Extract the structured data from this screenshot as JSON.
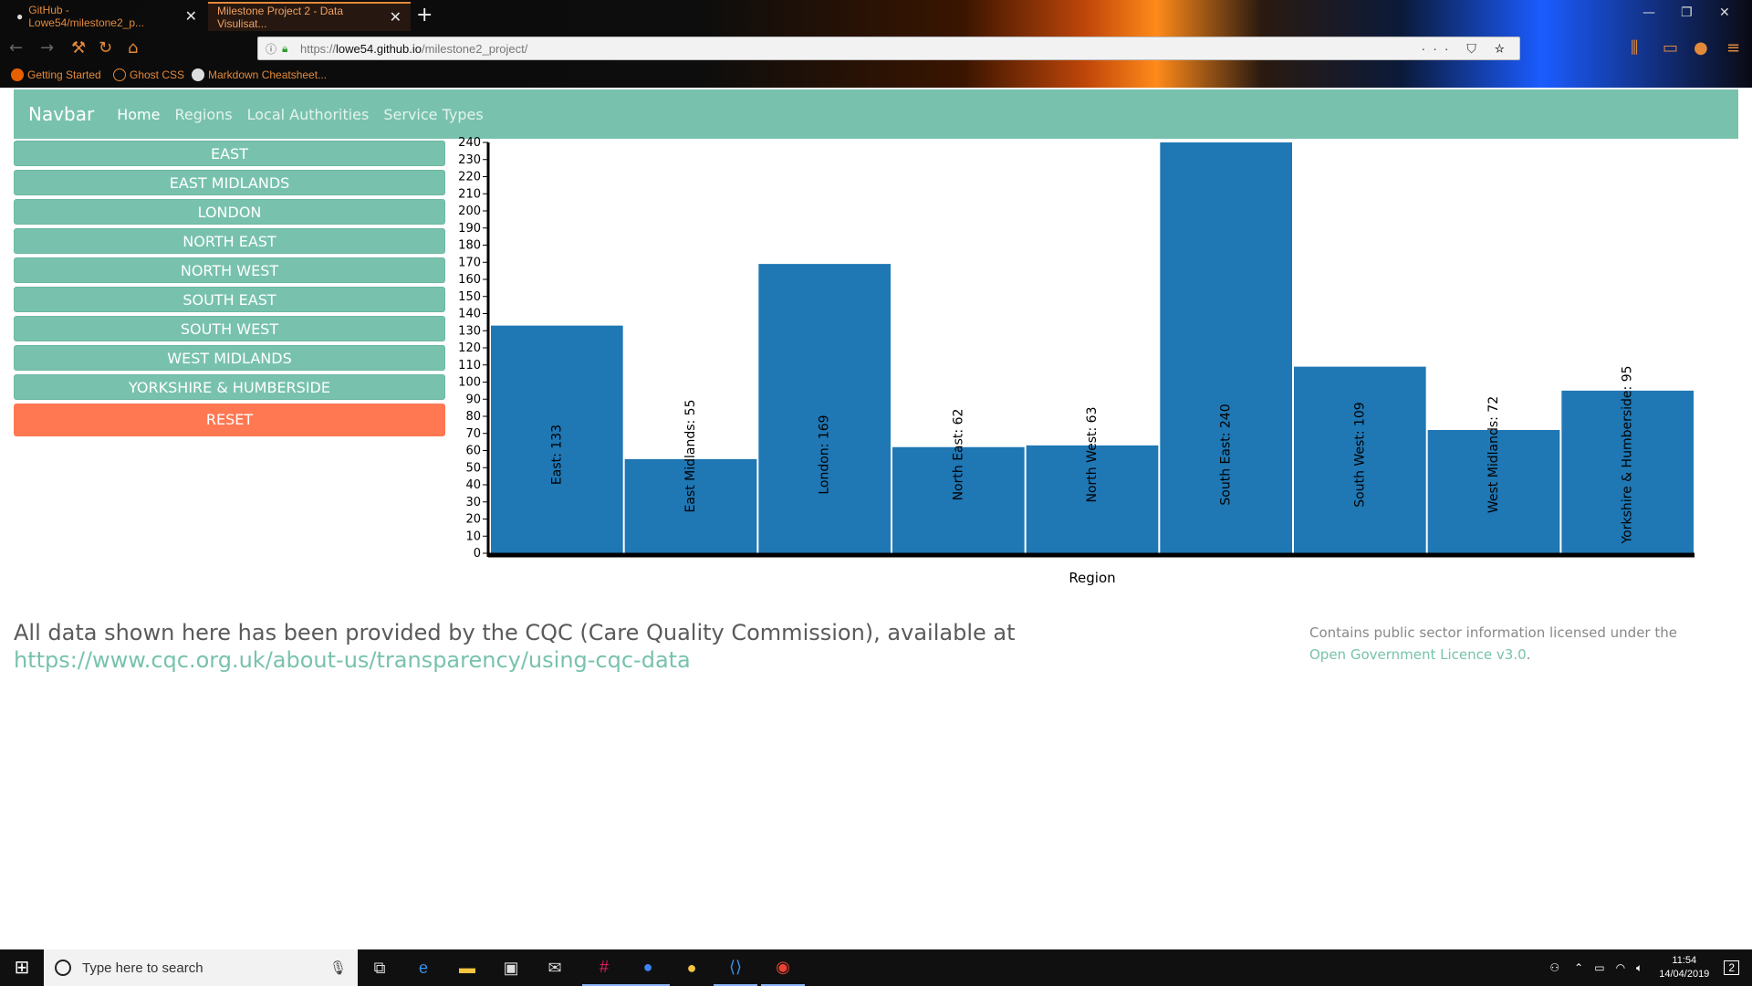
{
  "browser": {
    "tabs": [
      {
        "title": "GitHub - Lowe54/milestone2_p..."
      },
      {
        "title": "Milestone Project 2 - Data Visulisat..."
      }
    ],
    "url_scheme": "https://",
    "url_host": "lowe54.github.io",
    "url_path": "/milestone2_project/",
    "bookmarks": [
      "Getting Started",
      "Ghost CSS",
      "Markdown Cheatsheet..."
    ]
  },
  "navbar": {
    "brand": "Navbar",
    "links": [
      "Home",
      "Regions",
      "Local Authorities",
      "Service Types"
    ]
  },
  "sidebar": {
    "regions": [
      "EAST",
      "EAST MIDLANDS",
      "LONDON",
      "NORTH EAST",
      "NORTH WEST",
      "SOUTH EAST",
      "SOUTH WEST",
      "WEST MIDLANDS",
      "YORKSHIRE & HUMBERSIDE"
    ],
    "reset_label": "RESET"
  },
  "chart_data": {
    "type": "bar",
    "categories": [
      "East",
      "East Midlands",
      "London",
      "North East",
      "North West",
      "South East",
      "South West",
      "West Midlands",
      "Yorkshire & Humberside"
    ],
    "values": [
      133,
      55,
      169,
      62,
      63,
      240,
      109,
      72,
      95
    ],
    "data_labels": [
      "East: 133",
      "East Midlands: 55",
      "London: 169",
      "North East: 62",
      "North West: 63",
      "South East: 240",
      "South West: 109",
      "West Midlands: 72",
      "Yorkshire & Humberside: 95"
    ],
    "xlabel": "Region",
    "ylabel": "",
    "ylim": [
      0,
      240
    ],
    "yticks": [
      0,
      10,
      20,
      30,
      40,
      50,
      60,
      70,
      80,
      90,
      100,
      110,
      120,
      130,
      140,
      150,
      160,
      170,
      180,
      190,
      200,
      210,
      220,
      230,
      240
    ],
    "bar_color": "#1f77b4",
    "grid": false,
    "legend": false
  },
  "footer": {
    "text": "All data shown here has been provided by the CQC (Care Quality Commission), available at",
    "link": "https://www.cqc.org.uk/about-us/transparency/using-cqc-data",
    "licence_text": "Contains public sector information licensed under the",
    "licence_link": "Open Government Licence v3.0",
    "licence_end": "."
  },
  "taskbar": {
    "search_placeholder": "Type here to search",
    "time": "11:54",
    "date": "14/04/2019",
    "notifications": "2"
  },
  "colors": {
    "primary": "#78c2ad",
    "danger": "#ff7851",
    "bar": "#1f77b4"
  }
}
